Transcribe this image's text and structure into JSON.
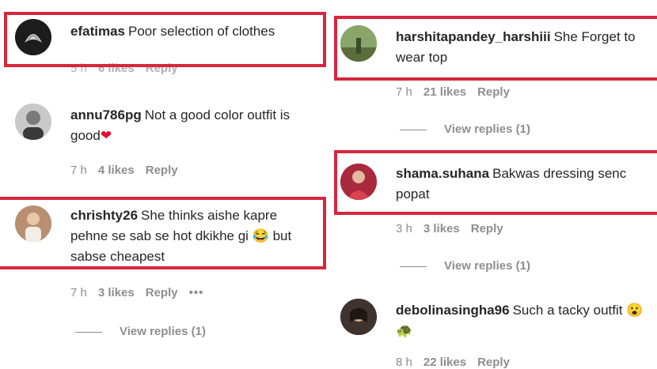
{
  "left_column": [
    {
      "username": "efatimas",
      "text": "Poor selection of clothes",
      "time": "5 h",
      "likes": "6 likes",
      "reply": "Reply",
      "avatar": "calligraphy-avatar"
    },
    {
      "username": "annu786pg",
      "text": "Not a good color outfit is good",
      "emoji": "❤",
      "time": "7 h",
      "likes": "4 likes",
      "reply": "Reply",
      "avatar": "person-avatar"
    },
    {
      "username": "chrishty26",
      "text": "She thinks aishe kapre pehne se sab se hot dkikhe gi",
      "emoji": "😂",
      "text_after": "but sabse cheapest",
      "time": "7 h",
      "likes": "3 likes",
      "reply": "Reply",
      "more": "•••",
      "view_replies": "View replies (1)"
    }
  ],
  "right_column": [
    {
      "username": "harshitapandey_harshiii",
      "text": "She Forget to wear top",
      "time": "7 h",
      "likes": "21 likes",
      "reply": "Reply",
      "view_replies": "View replies (1)"
    },
    {
      "username": "shama.suhana",
      "text": "Bakwas dressing senc popat",
      "time": "3 h",
      "likes": "3 likes",
      "reply": "Reply",
      "view_replies": "View replies (1)"
    },
    {
      "username": "debolinasingha96",
      "text": "Such a tacky outfit",
      "emoji": "😮🐢",
      "time": "8 h",
      "likes": "22 likes",
      "reply": "Reply"
    }
  ],
  "colors": {
    "highlight": "#d7263d",
    "meta": "#8e8e8e",
    "text": "#262626"
  }
}
